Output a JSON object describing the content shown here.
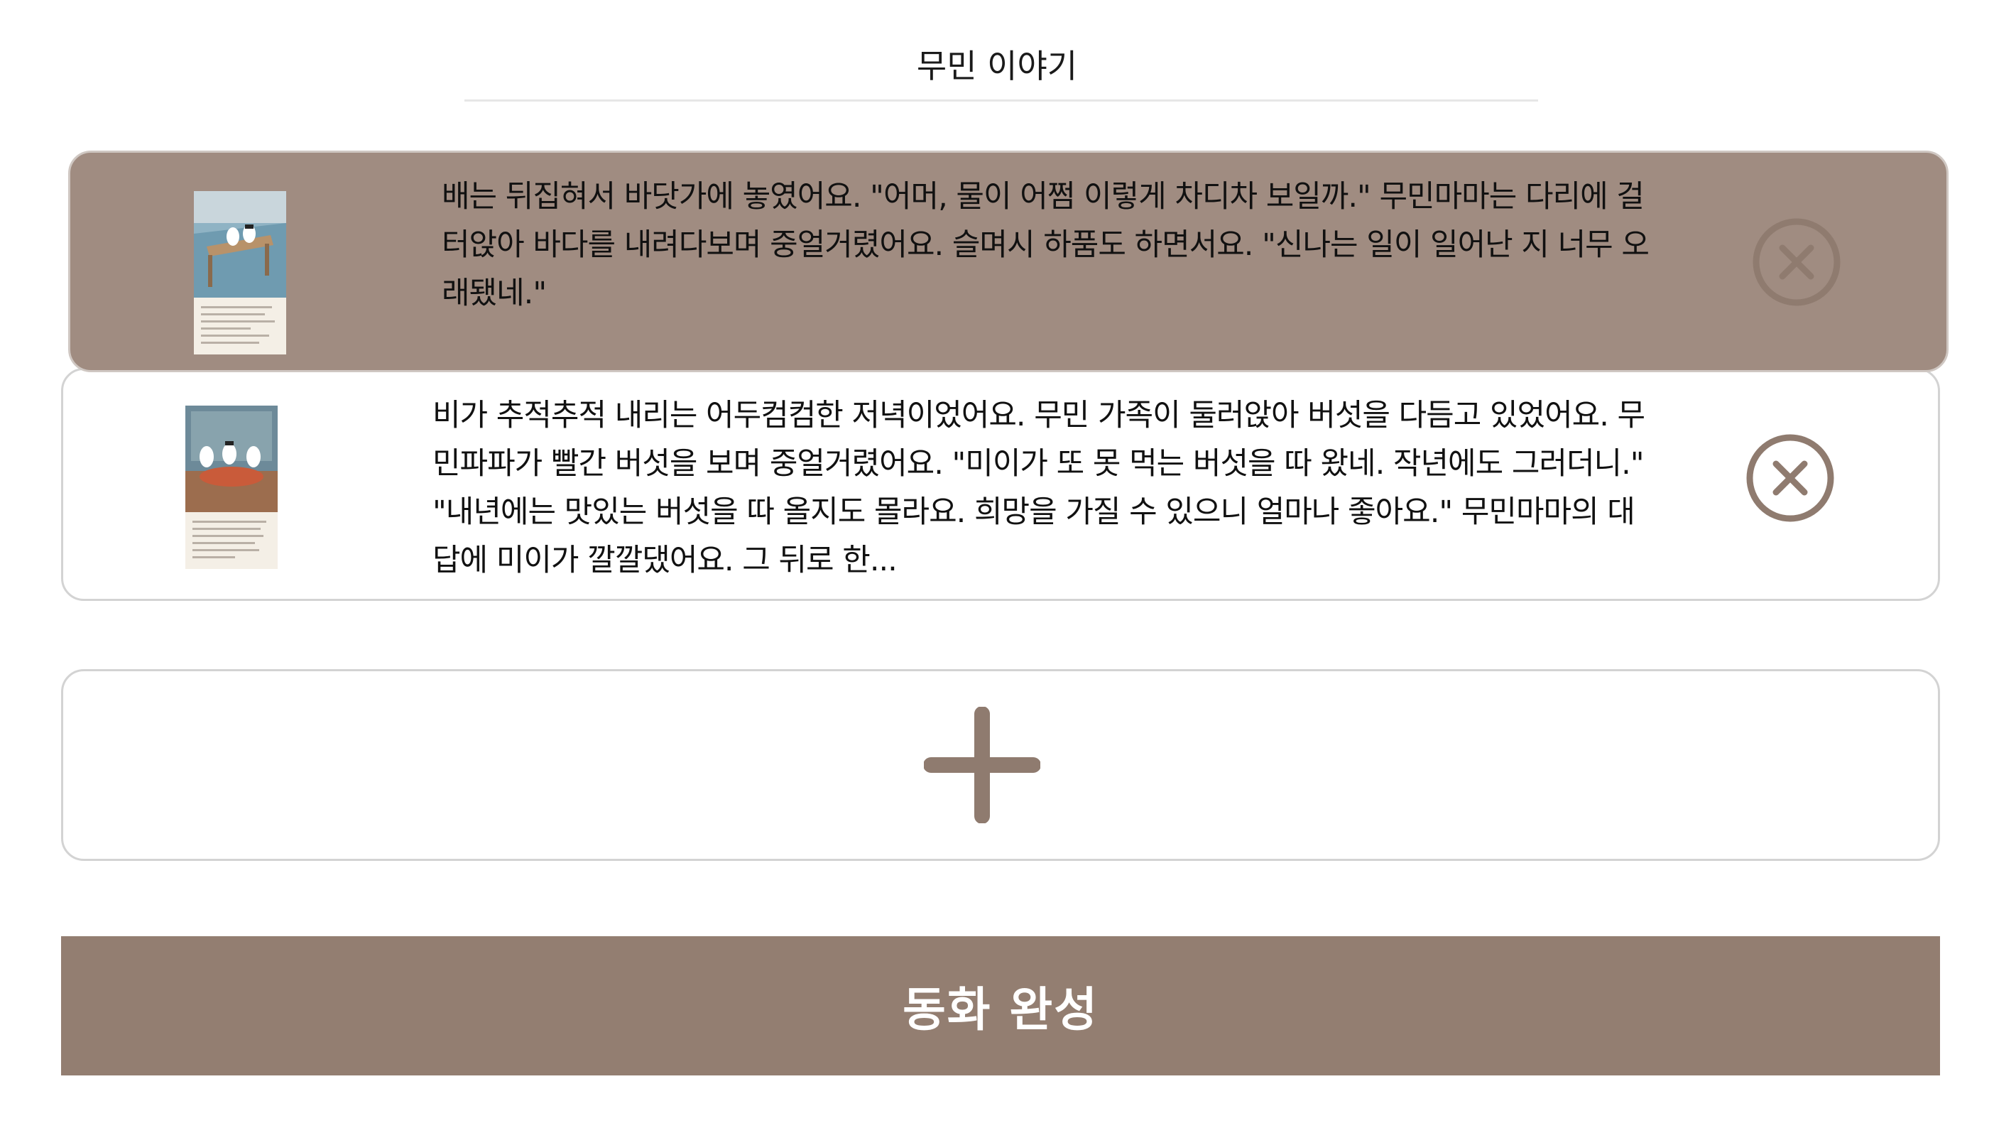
{
  "header": {
    "title": "무민 이야기"
  },
  "story_pages": [
    {
      "selected": true,
      "text": "배는 뒤집혀서 바닷가에 놓였어요. \"어머, 물이 어쩜 이렇게 차디차 보일까.\" 무민마마는 다리에 걸터앉아 바다를 내려다보며 중얼거렸어요. 슬며시 하품도 하면서요. \"신나는 일이 일어난 지 너무 오래됐네.\"",
      "thumbnail_icon": "story-page-thumbnail",
      "delete_icon": "close-circle-icon"
    },
    {
      "selected": false,
      "text": "비가 추적추적 내리는 어두컴컴한 저녁이었어요. 무민 가족이 둘러앉아 버섯을 다듬고 있었어요. 무민파파가 빨간 버섯을 보며 중얼거렸어요. \"미이가 또 못 먹는 버섯을 따 왔네. 작년에도 그러더니.\" \"내년에는 맛있는 버섯을 따 올지도 몰라요. 희망을 가질 수 있으니 얼마나 좋아요.\" 무민마마의 대답에 미이가 깔깔댔어요. 그 뒤로 한...",
      "thumbnail_icon": "story-page-thumbnail",
      "delete_icon": "close-circle-icon"
    }
  ],
  "add_page": {
    "icon": "plus-icon"
  },
  "complete_button": {
    "label": "동화 완성"
  },
  "colors": {
    "selected_card_bg": "#a08c81",
    "icon_brown": "#8f7b6f",
    "complete_button_bg": "#937e71"
  }
}
